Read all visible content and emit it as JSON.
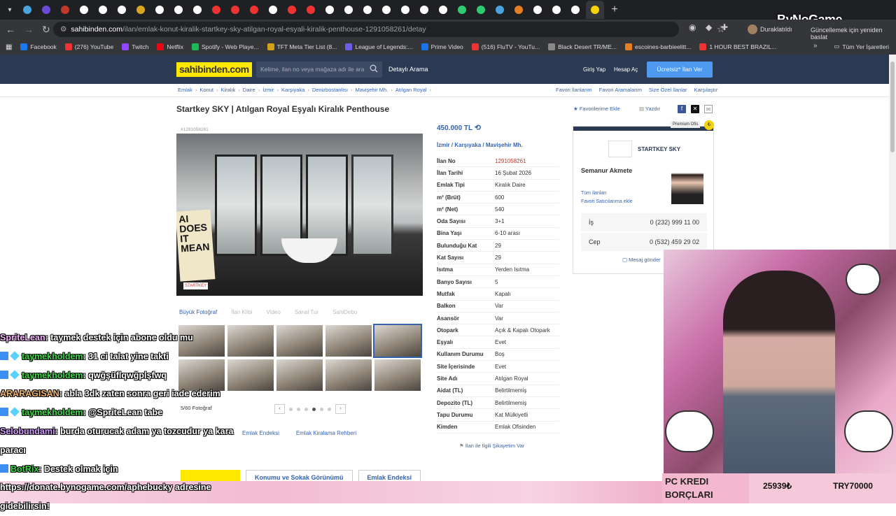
{
  "browser": {
    "url_host": "sahibinden.com",
    "url_path": "/ilan/emlak-konut-kiralik-startkey-sky-atilgan-royal-esyali-kiralik-penthouse-1291058261/detay",
    "pause_label": "Duraklatıldı",
    "update_label": "Güncellemek için yeniden başlat",
    "bookmarks": [
      "Facebook",
      "(276) YouTube",
      "Twitch",
      "Netflix",
      "Spotify - Web Playe...",
      "TFT Meta Tier List (8...",
      "League of Legends:...",
      "Prime Video",
      "(516) FluTV - YouTu...",
      "Black Desert TR/ME...",
      "escoines-barbieelitt...",
      "1 HOUR BEST BRAZIL..."
    ],
    "bookmarks_all": "Tüm Yer İşaretleri",
    "colors": {
      "chrome_dark": "#1f2023",
      "chrome_mid": "#35363a"
    }
  },
  "header": {
    "logo": "sahibinden.com",
    "search_placeholder": "Kelime, ilan no veya mağaza adı ile ara",
    "detailed_search": "Detaylı Arama",
    "login": "Giriş Yap",
    "register": "Hesap Aç",
    "post_ad": "Ücretsiz* İlan Ver",
    "colors": {
      "nav": "#2b3952",
      "logo_bg": "#ffe800",
      "button": "#4d9af0"
    }
  },
  "breadcrumb": [
    "Emlak",
    "Konut",
    "Kiralık",
    "Daire",
    "İzmir",
    "Karşıyaka",
    "Denizbostanlısı",
    "Mavişehir Mh.",
    "Atılgan Royal"
  ],
  "breadcrumb_right": [
    "Favori İlanlarım",
    "Favori Aramalarım",
    "Size Özel İlanlar",
    "Karşılaştır"
  ],
  "listing": {
    "title": "Startkey SKY | Atılgan Royal Eşyalı Kiralık Penthouse",
    "add_favorite": "Favorilerime Ekle",
    "print": "Yazdır",
    "id_label": "#1291058261",
    "photo_sign": "AI DOES IT MEAN",
    "photo_watermark": "STARTKEY",
    "media_buttons": [
      "Büyük Fotoğraf",
      "İlan Klibi",
      "Video",
      "Sanal Tur",
      "SahiDebo"
    ],
    "photo_count": "5/60 Fotoğraf",
    "price": "450.000 TL",
    "location": [
      "İzmir",
      "Karşıyaka",
      "Mavişehir Mh."
    ],
    "details": [
      {
        "k": "İlan No",
        "v": "1291058261"
      },
      {
        "k": "İlan Tarihi",
        "v": "16 Şubat 2026"
      },
      {
        "k": "Emlak Tipi",
        "v": "Kiralık Daire"
      },
      {
        "k": "m² (Brüt)",
        "v": "600"
      },
      {
        "k": "m² (Net)",
        "v": "540"
      },
      {
        "k": "Oda Sayısı",
        "v": "3+1"
      },
      {
        "k": "Bina Yaşı",
        "v": "6-10 arası"
      },
      {
        "k": "Bulunduğu Kat",
        "v": "29"
      },
      {
        "k": "Kat Sayısı",
        "v": "29"
      },
      {
        "k": "Isıtma",
        "v": "Yerden Isıtma"
      },
      {
        "k": "Banyo Sayısı",
        "v": "5"
      },
      {
        "k": "Mutfak",
        "v": "Kapalı"
      },
      {
        "k": "Balkon",
        "v": "Var"
      },
      {
        "k": "Asansör",
        "v": "Var"
      },
      {
        "k": "Otopark",
        "v": "Açık & Kapalı Otopark"
      },
      {
        "k": "Eşyalı",
        "v": "Evet"
      },
      {
        "k": "Kullanım Durumu",
        "v": "Boş"
      },
      {
        "k": "Site İçerisinde",
        "v": "Evet"
      },
      {
        "k": "Site Adı",
        "v": "Atılgan Royal"
      },
      {
        "k": "Aidat (TL)",
        "v": "Belirtilmemiş"
      },
      {
        "k": "Depozito (TL)",
        "v": "Belirtilmemiş"
      },
      {
        "k": "Tapu Durumu",
        "v": "Kat Mülkiyetli"
      },
      {
        "k": "Kimden",
        "v": "Emlak Ofisinden"
      }
    ],
    "complaint": "İlan ile İlgili Şikayetim Var",
    "bottom_links": [
      "Emlak Endeksi",
      "Emlak Kiralama Rehberi"
    ],
    "bottom_buttons": [
      "Konumu ve Sokak Görünümü",
      "Emlak Endeksi"
    ]
  },
  "seller": {
    "premium": "Premium Ofis",
    "store": "STARTKEY SKY",
    "agent": "Semanur Akmete",
    "all_ads": "Tüm ilanları",
    "add_fav_seller": "Favori Satıcılarıma ekle",
    "phones": [
      {
        "type": "İş",
        "num": "0 (232) 999 11 00"
      },
      {
        "type": "Cep",
        "num": "0 (532) 459 29 02"
      }
    ],
    "message": "Mesaj gönder"
  },
  "overlay": {
    "brand": "ByNoGame",
    "kredi_label": "PC KREDI BORÇLARI",
    "kredi_amount": "25939₺",
    "kredi_target": "TRY70000"
  },
  "chat": [
    {
      "user": "SpriteLean",
      "msg": ": taymek destek için abone oldu mu",
      "cls": "u1",
      "icons": 0
    },
    {
      "user": "taymekholdem",
      "msg": ": 31 ci talat yine takti",
      "cls": "u2",
      "icons": 2
    },
    {
      "user": "taymekholdem",
      "msg": ": qwğşüflqwğplşfwq",
      "cls": "u2",
      "icons": 2
    },
    {
      "user": "ARARAGISAN",
      "msg": ": abla 3dk zaten sonra geri iade ederim",
      "cls": "u3",
      "icons": 0
    },
    {
      "user": "taymekholdem",
      "msg": ": @SpriteLean tabe",
      "cls": "u2",
      "icons": 2
    },
    {
      "user": "Selobundami",
      "msg": ": burda oturucak adam ya tozcudur ya kara",
      "cls": "u4",
      "icons": 0
    },
    {
      "user": "",
      "msg": "paracı",
      "cls": "",
      "icons": 0
    },
    {
      "user": "BotRix",
      "msg": ": Destek olmak için",
      "cls": "u2",
      "icons": 1
    },
    {
      "user": "",
      "msg": "https://donate.bynogame.com/aphebucky adresine",
      "cls": "",
      "icons": 0
    },
    {
      "user": "",
      "msg": "gidebilirsin!",
      "cls": "",
      "icons": 0
    }
  ]
}
